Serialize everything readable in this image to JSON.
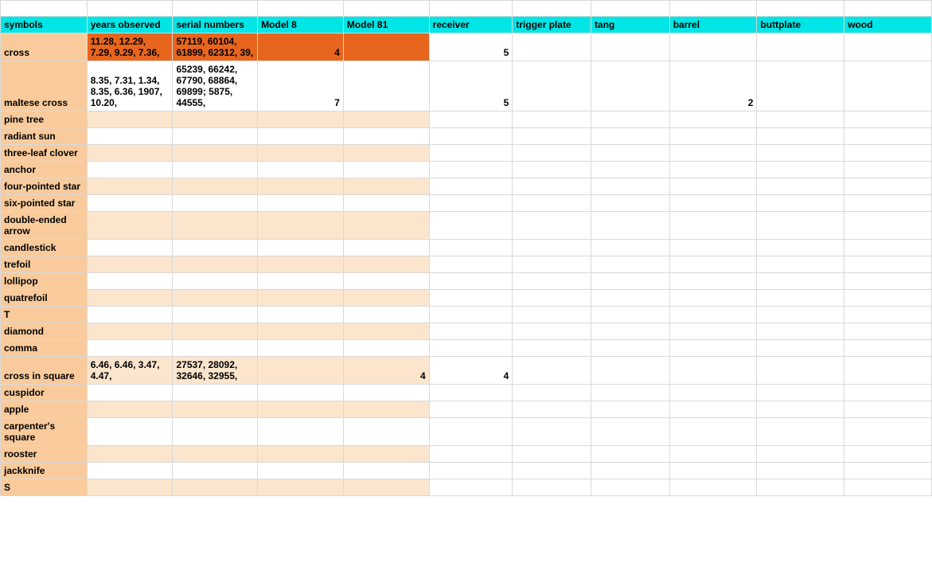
{
  "headers": {
    "symbols": "symbols",
    "years": "years observed",
    "serials": "serial numbers",
    "m8": "Model 8",
    "m81": "Model 81",
    "receiver": "receiver",
    "trigger": "trigger plate",
    "tang": "tang",
    "barrel": "barrel",
    "buttplate": "buttplate",
    "wood": "wood"
  },
  "rows": [
    {
      "symbol": "cross",
      "years": "11.28, 12.29, 7.29, 9.29, 7.36,",
      "serials": "57119, 60104, 61899, 62312, 39,",
      "m8": "4",
      "m81": "",
      "receiver": "5",
      "trigger": "",
      "tang": "",
      "barrel": "",
      "buttplate": "",
      "wood": "",
      "shade": false,
      "highlight": true,
      "tall": true
    },
    {
      "symbol": "maltese cross",
      "years": "8.35, 7.31, 1.34, 8.35, 6.36, 1907, 10.20,",
      "serials": "65239, 66242, 67790, 68864, 69899; 5875, 44555,",
      "m8": "7",
      "m81": "",
      "receiver": "5",
      "trigger": "",
      "tang": "",
      "barrel": "2",
      "buttplate": "",
      "wood": "",
      "shade": false,
      "highlight": false,
      "tall": true
    },
    {
      "symbol": "pine tree",
      "years": "",
      "serials": "",
      "m8": "",
      "m81": "",
      "receiver": "",
      "trigger": "",
      "tang": "",
      "barrel": "",
      "buttplate": "",
      "wood": "",
      "shade": true
    },
    {
      "symbol": "radiant sun",
      "years": "",
      "serials": "",
      "m8": "",
      "m81": "",
      "receiver": "",
      "trigger": "",
      "tang": "",
      "barrel": "",
      "buttplate": "",
      "wood": "",
      "shade": false
    },
    {
      "symbol": "three-leaf clover",
      "years": "",
      "serials": "",
      "m8": "",
      "m81": "",
      "receiver": "",
      "trigger": "",
      "tang": "",
      "barrel": "",
      "buttplate": "",
      "wood": "",
      "shade": true
    },
    {
      "symbol": "anchor",
      "years": "",
      "serials": "",
      "m8": "",
      "m81": "",
      "receiver": "",
      "trigger": "",
      "tang": "",
      "barrel": "",
      "buttplate": "",
      "wood": "",
      "shade": false
    },
    {
      "symbol": "four-pointed star",
      "years": "",
      "serials": "",
      "m8": "",
      "m81": "",
      "receiver": "",
      "trigger": "",
      "tang": "",
      "barrel": "",
      "buttplate": "",
      "wood": "",
      "shade": true
    },
    {
      "symbol": "six-pointed star",
      "years": "",
      "serials": "",
      "m8": "",
      "m81": "",
      "receiver": "",
      "trigger": "",
      "tang": "",
      "barrel": "",
      "buttplate": "",
      "wood": "",
      "shade": false
    },
    {
      "symbol": "double-ended arrow",
      "years": "",
      "serials": "",
      "m8": "",
      "m81": "",
      "receiver": "",
      "trigger": "",
      "tang": "",
      "barrel": "",
      "buttplate": "",
      "wood": "",
      "shade": true
    },
    {
      "symbol": "candlestick",
      "years": "",
      "serials": "",
      "m8": "",
      "m81": "",
      "receiver": "",
      "trigger": "",
      "tang": "",
      "barrel": "",
      "buttplate": "",
      "wood": "",
      "shade": false
    },
    {
      "symbol": "trefoil",
      "years": "",
      "serials": "",
      "m8": "",
      "m81": "",
      "receiver": "",
      "trigger": "",
      "tang": "",
      "barrel": "",
      "buttplate": "",
      "wood": "",
      "shade": true
    },
    {
      "symbol": "lollipop",
      "years": "",
      "serials": "",
      "m8": "",
      "m81": "",
      "receiver": "",
      "trigger": "",
      "tang": "",
      "barrel": "",
      "buttplate": "",
      "wood": "",
      "shade": false
    },
    {
      "symbol": "quatrefoil",
      "years": "",
      "serials": "",
      "m8": "",
      "m81": "",
      "receiver": "",
      "trigger": "",
      "tang": "",
      "barrel": "",
      "buttplate": "",
      "wood": "",
      "shade": true
    },
    {
      "symbol": "T",
      "years": "",
      "serials": "",
      "m8": "",
      "m81": "",
      "receiver": "",
      "trigger": "",
      "tang": "",
      "barrel": "",
      "buttplate": "",
      "wood": "",
      "shade": false
    },
    {
      "symbol": "diamond",
      "years": "",
      "serials": "",
      "m8": "",
      "m81": "",
      "receiver": "",
      "trigger": "",
      "tang": "",
      "barrel": "",
      "buttplate": "",
      "wood": "",
      "shade": true
    },
    {
      "symbol": "comma",
      "years": "",
      "serials": "",
      "m8": "",
      "m81": "",
      "receiver": "",
      "trigger": "",
      "tang": "",
      "barrel": "",
      "buttplate": "",
      "wood": "",
      "shade": false
    },
    {
      "symbol": "cross in square",
      "years": "6.46, 6.46, 3.47, 4.47,",
      "serials": "27537, 28092, 32646, 32955,",
      "m8": "",
      "m81": "4",
      "receiver": "4",
      "trigger": "",
      "tang": "",
      "barrel": "",
      "buttplate": "",
      "wood": "",
      "shade": true,
      "tall": true
    },
    {
      "symbol": "cuspidor",
      "years": "",
      "serials": "",
      "m8": "",
      "m81": "",
      "receiver": "",
      "trigger": "",
      "tang": "",
      "barrel": "",
      "buttplate": "",
      "wood": "",
      "shade": false
    },
    {
      "symbol": "apple",
      "years": "",
      "serials": "",
      "m8": "",
      "m81": "",
      "receiver": "",
      "trigger": "",
      "tang": "",
      "barrel": "",
      "buttplate": "",
      "wood": "",
      "shade": true
    },
    {
      "symbol": "carpenter's square",
      "years": "",
      "serials": "",
      "m8": "",
      "m81": "",
      "receiver": "",
      "trigger": "",
      "tang": "",
      "barrel": "",
      "buttplate": "",
      "wood": "",
      "shade": false
    },
    {
      "symbol": "rooster",
      "years": "",
      "serials": "",
      "m8": "",
      "m81": "",
      "receiver": "",
      "trigger": "",
      "tang": "",
      "barrel": "",
      "buttplate": "",
      "wood": "",
      "shade": true
    },
    {
      "symbol": "jackknife",
      "years": "",
      "serials": "",
      "m8": "",
      "m81": "",
      "receiver": "",
      "trigger": "",
      "tang": "",
      "barrel": "",
      "buttplate": "",
      "wood": "",
      "shade": false
    },
    {
      "symbol": "S",
      "years": "",
      "serials": "",
      "m8": "",
      "m81": "",
      "receiver": "",
      "trigger": "",
      "tang": "",
      "barrel": "",
      "buttplate": "",
      "wood": "",
      "shade": true
    }
  ]
}
